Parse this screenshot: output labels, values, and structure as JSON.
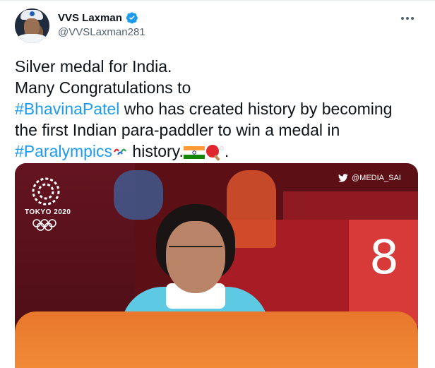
{
  "author": {
    "name": "VVS Laxman",
    "handle": "@VVSLaxman281",
    "verified": true,
    "verified_color": "#1d9bf0"
  },
  "menu": {
    "icon": "more-horizontal-icon"
  },
  "tweet": {
    "line1": "Silver medal for India.",
    "line2": "Many Congratulations to",
    "hashtag1": "#BhavinaPatel",
    "line3_rest": " who has created history by becoming",
    "line4": "the first Indian para-paddler to win a medal in",
    "hashtag2": "#Paralympics",
    "line5_rest": " history.",
    "line5_end": ".",
    "emojis": [
      "paralympics-agitos-icon",
      "india-flag-icon",
      "table-tennis-paddle-icon"
    ],
    "hashtag_color": "#1d9bf0"
  },
  "media": {
    "logo_text": "TOKYO 2020",
    "credit": "@MEDIA_SAI",
    "score_digit": "8",
    "icons": [
      "tokyo-2020-emblem-icon",
      "olympic-rings-icon",
      "twitter-bird-icon"
    ]
  }
}
